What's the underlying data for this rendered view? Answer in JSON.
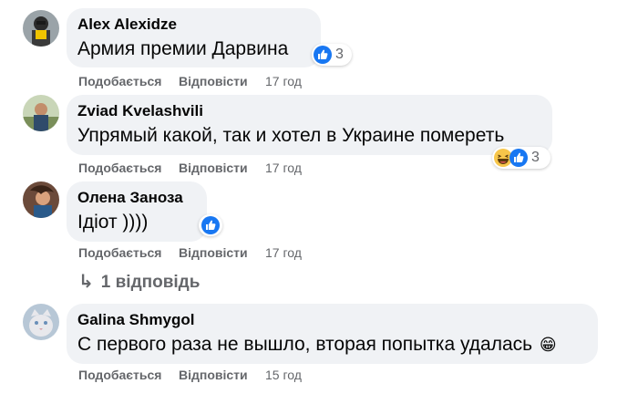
{
  "comments": [
    {
      "author": "Alex Alexidze",
      "text": "Армия премии Дарвина",
      "reaction_count": "3",
      "reactions": [
        "like"
      ],
      "like_label": "Подобається",
      "reply_label": "Відповісти",
      "time": "17 год"
    },
    {
      "author": "Zviad Kvelashvili",
      "text": "Упрямый какой, так и хотел в Украине помереть",
      "reaction_count": "3",
      "reactions": [
        "haha",
        "like"
      ],
      "like_label": "Подобається",
      "reply_label": "Відповісти",
      "time": "17 год"
    },
    {
      "author": "Олена Заноза",
      "text": "Ідіот ))))",
      "reactions": [
        "like"
      ],
      "like_label": "Подобається",
      "reply_label": "Відповісти",
      "time": "17 год",
      "replies_link": "1 відповідь"
    },
    {
      "author": "Galina Shmygol",
      "text": "С первого раза не вышло, вторая попытка удалась",
      "emoji": "😁",
      "like_label": "Подобається",
      "reply_label": "Відповісти",
      "time": "15 год"
    }
  ],
  "colors": {
    "bubble": "#f0f2f5",
    "secondary_text": "#65676b",
    "like_blue": "#1877f2",
    "haha_yellow": "#f7c64a"
  }
}
